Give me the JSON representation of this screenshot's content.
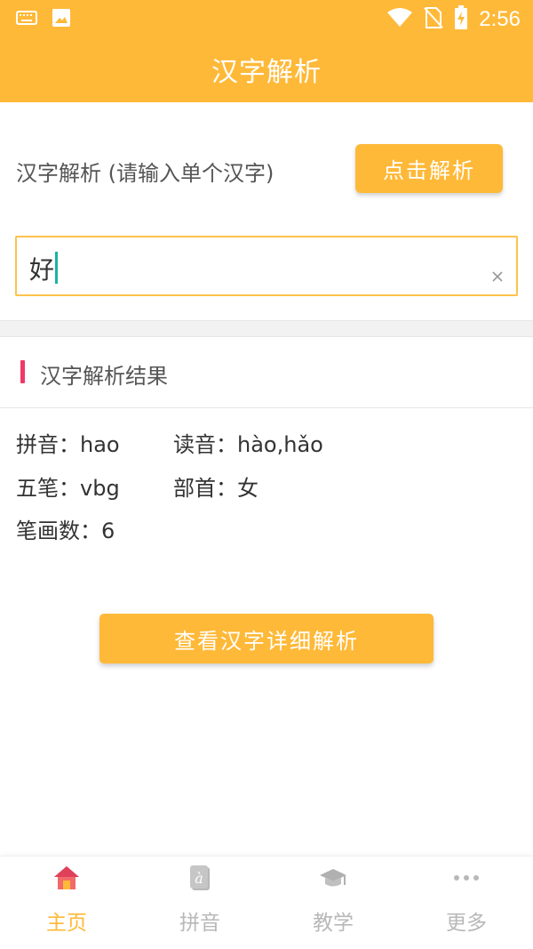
{
  "status_bar": {
    "time": "2:56",
    "icons": [
      "keyboard-icon",
      "image-icon",
      "wifi-icon",
      "no-sim-icon",
      "battery-charging-icon"
    ]
  },
  "app_bar": {
    "title": "汉字解析"
  },
  "input": {
    "label": "汉字解析 (请输入单个汉字)",
    "button_label": "点击解析",
    "value": "好"
  },
  "result": {
    "title": "汉字解析结果",
    "pinyin_key": "拼音：",
    "pinyin_value": "hao",
    "reading_key": "读音：",
    "reading_value": "hào,hǎo",
    "wubi_key": "五笔：",
    "wubi_value": "vbg",
    "radical_key": "部首：",
    "radical_value": "女",
    "strokes_key": "笔画数：",
    "strokes_value": "6"
  },
  "detail_button": {
    "label": "查看汉字详细解析"
  },
  "bottom_nav": {
    "items": [
      {
        "label": "主页",
        "icon": "home-icon",
        "active": true
      },
      {
        "label": "拼音",
        "icon": "pinyin-book-icon",
        "active": false
      },
      {
        "label": "教学",
        "icon": "graduation-cap-icon",
        "active": false
      },
      {
        "label": "更多",
        "icon": "more-dots-icon",
        "active": false
      }
    ]
  },
  "colors": {
    "primary": "#FFB938",
    "accent": "#F0386B",
    "caret": "#1AB3A6",
    "inactive": "#B8B8B8"
  }
}
